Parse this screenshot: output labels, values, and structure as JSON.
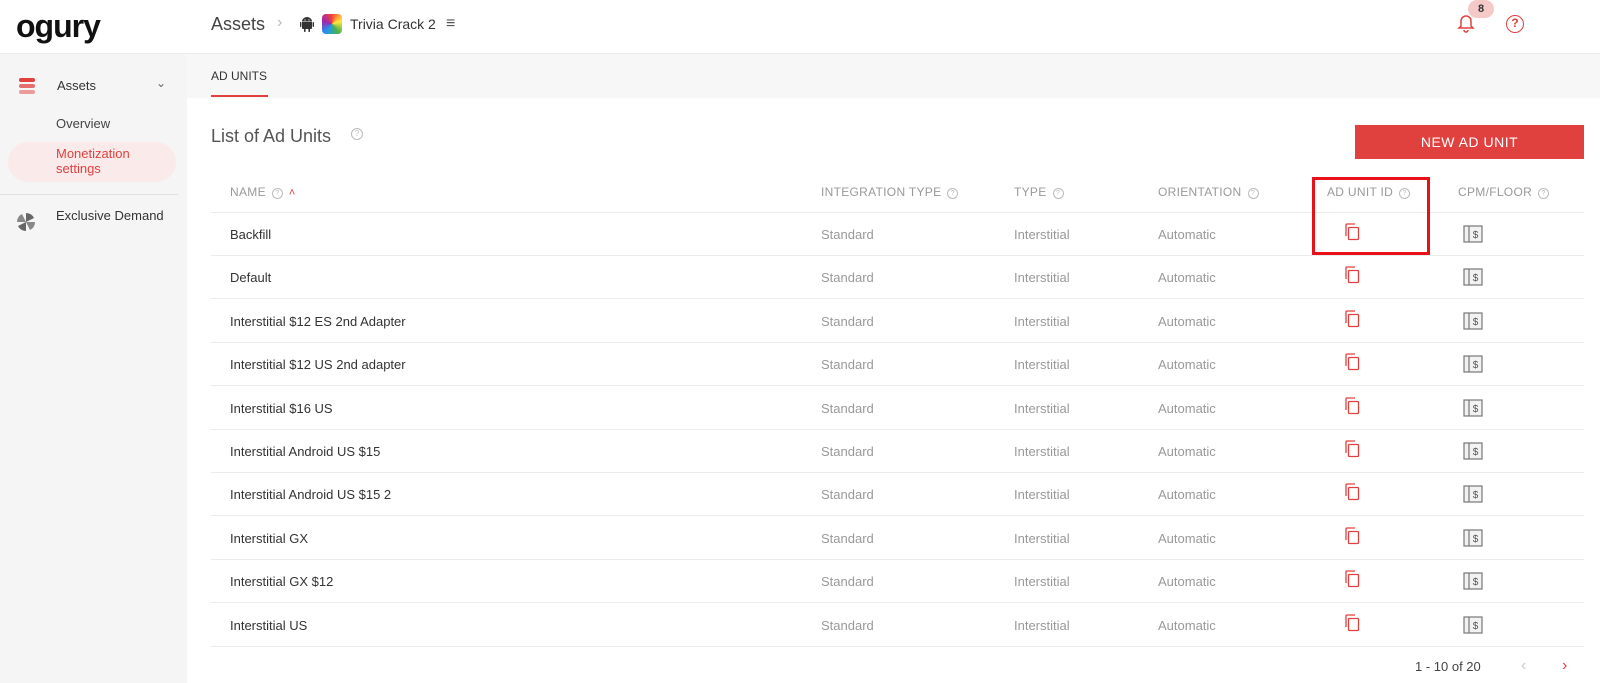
{
  "header": {
    "logo": "ogury",
    "breadcrumb_root": "Assets",
    "breadcrumb_sep": "›",
    "app_name": "Trivia Crack 2",
    "notifications_count": "8",
    "help": "?"
  },
  "sidebar": {
    "assets_label": "Assets",
    "overview_label": "Overview",
    "monetization_label": "Monetization settings",
    "exclusive_label": "Exclusive Demand"
  },
  "tabs": [
    {
      "label": "AD UNITS"
    }
  ],
  "main": {
    "title": "List of Ad Units",
    "new_button": "NEW AD UNIT"
  },
  "table": {
    "columns": [
      "NAME",
      "INTEGRATION TYPE",
      "TYPE",
      "ORIENTATION",
      "AD UNIT ID",
      "CPM/FLOOR"
    ],
    "rows": [
      {
        "name": "Backfill",
        "integration": "Standard",
        "type": "Interstitial",
        "orientation": "Automatic"
      },
      {
        "name": "Default",
        "integration": "Standard",
        "type": "Interstitial",
        "orientation": "Automatic"
      },
      {
        "name": "Interstitial $12 ES 2nd Adapter",
        "integration": "Standard",
        "type": "Interstitial",
        "orientation": "Automatic"
      },
      {
        "name": "Interstitial $12 US 2nd adapter",
        "integration": "Standard",
        "type": "Interstitial",
        "orientation": "Automatic"
      },
      {
        "name": "Interstitial $16 US",
        "integration": "Standard",
        "type": "Interstitial",
        "orientation": "Automatic"
      },
      {
        "name": "Interstitial Android US $15",
        "integration": "Standard",
        "type": "Interstitial",
        "orientation": "Automatic"
      },
      {
        "name": "Interstitial Android US $15 2",
        "integration": "Standard",
        "type": "Interstitial",
        "orientation": "Automatic"
      },
      {
        "name": "Interstitial GX",
        "integration": "Standard",
        "type": "Interstitial",
        "orientation": "Automatic"
      },
      {
        "name": "Interstitial GX $12",
        "integration": "Standard",
        "type": "Interstitial",
        "orientation": "Automatic"
      },
      {
        "name": "Interstitial US",
        "integration": "Standard",
        "type": "Interstitial",
        "orientation": "Automatic"
      }
    ]
  },
  "pagination": {
    "summary": "1 - 10 of 20",
    "prev": "‹",
    "next": "›"
  },
  "icons": {
    "copy": "copy-icon",
    "cpm": "dollar-bill-icon",
    "accent_color": "#e0413f"
  }
}
